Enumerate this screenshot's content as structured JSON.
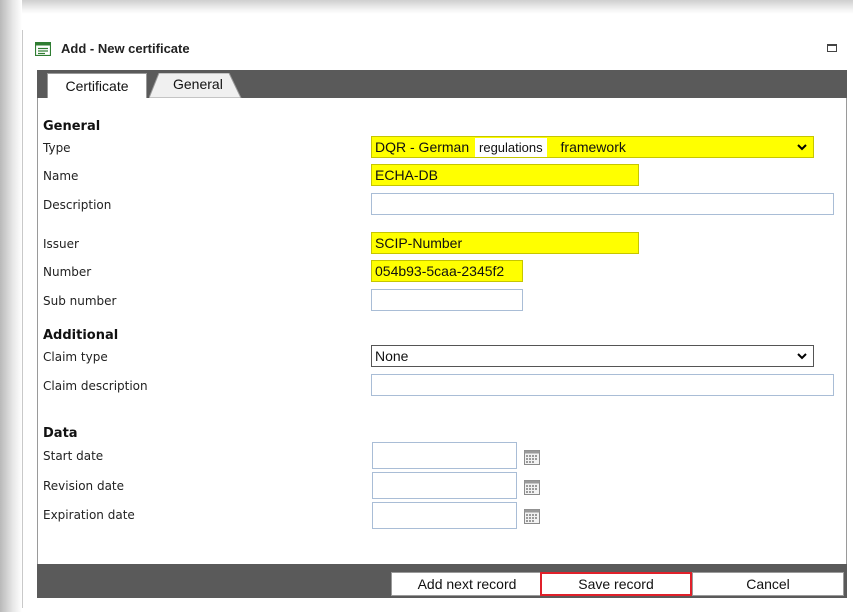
{
  "dialog": {
    "title": "Add - New certificate"
  },
  "tabs": [
    {
      "label": "Certificate",
      "active": true
    },
    {
      "label": "General",
      "active": false
    }
  ],
  "sections": {
    "general": "General",
    "additional": "Additional",
    "data": "Data"
  },
  "fields": {
    "type": {
      "label": "Type",
      "value_part1": "DQR - German",
      "value_part2": "regulations",
      "value_part3": "framework"
    },
    "name": {
      "label": "Name",
      "value": "ECHA-DB"
    },
    "description": {
      "label": "Description",
      "value": ""
    },
    "issuer": {
      "label": "Issuer",
      "value": "SCIP-Number"
    },
    "number": {
      "label": "Number",
      "value": "054b93-5caa-2345f2"
    },
    "sub_number": {
      "label": "Sub number",
      "value": ""
    },
    "claim_type": {
      "label": "Claim type",
      "value": "None"
    },
    "claim_description": {
      "label": "Claim description",
      "value": ""
    },
    "start_date": {
      "label": "Start date",
      "value": ""
    },
    "revision_date": {
      "label": "Revision date",
      "value": ""
    },
    "expiration_date": {
      "label": "Expiration date",
      "value": ""
    }
  },
  "footer": {
    "add_next_label": "Add next record",
    "save_label": "Save record",
    "cancel_label": "Cancel"
  },
  "colors": {
    "highlight": "#ffff00",
    "bar": "#5a5a5a",
    "save_outline": "#e0202a"
  },
  "icons": {
    "title": "form-icon",
    "maximize": "maximize-icon",
    "dropdown": "chevron-down-icon",
    "calendar": "calendar-icon"
  }
}
